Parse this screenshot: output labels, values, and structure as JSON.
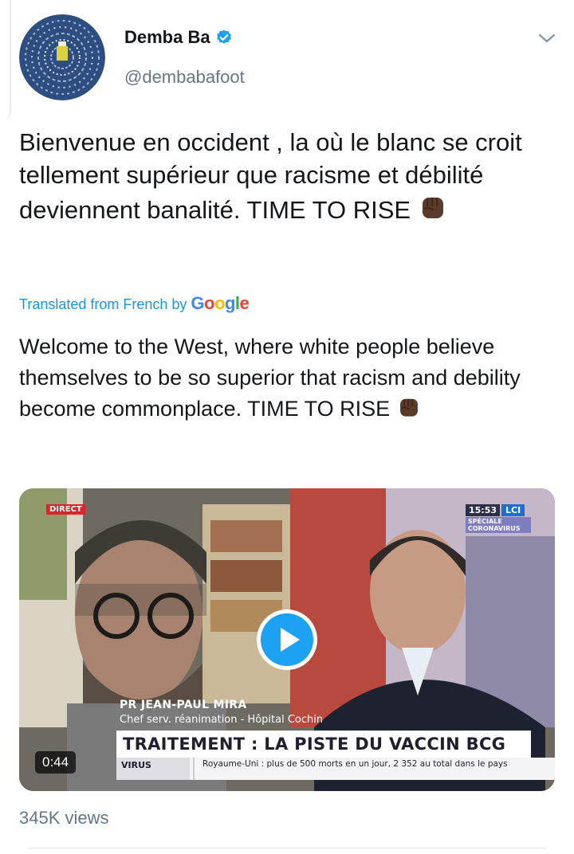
{
  "tweet": {
    "author": {
      "display_name": "Demba Ba",
      "handle": "@dembabafoot",
      "verified_icon": "verified-badge-icon"
    },
    "menu_icon": "chevron-down-icon",
    "text": "Bienvenue en occident , la où le blanc se croit tellement supérieur que racisme et débilité deviennent banalité. TIME TO RISE",
    "translation_label": "Translated from French by",
    "translation_provider": "Google",
    "translation_text": "Welcome to the West, where white people believe themselves to be so superior that racism and debility become commonplace. TIME TO RISE",
    "emoji": "raised-fist-dark-skin-icon",
    "views": "345K views"
  },
  "video": {
    "live_badge": "DIRECT",
    "clock": "15:53",
    "channel": "LCI",
    "special": "SPÉCIALE CORONAVIRUS",
    "guest_name": "PR JEAN-PAUL MIRA",
    "guest_role": "Chef serv. réanimation - Hôpital Cochin",
    "headline": "TRAITEMENT : LA PISTE DU VACCIN BCG",
    "ticker_label": "VIRUS",
    "ticker_text": "Royaume-Uni : plus de 500 morts en un jour, 2 352 au total dans le pays",
    "duration": "0:44",
    "play_icon": "play-icon",
    "colors": {
      "play_blue": "#1da1f2",
      "live_red": "#d7262c",
      "channel_blue": "#1f6fd1"
    }
  },
  "colors": {
    "link": "#1b95e0",
    "secondary_text": "#657786",
    "verified": "#1da1f2"
  }
}
